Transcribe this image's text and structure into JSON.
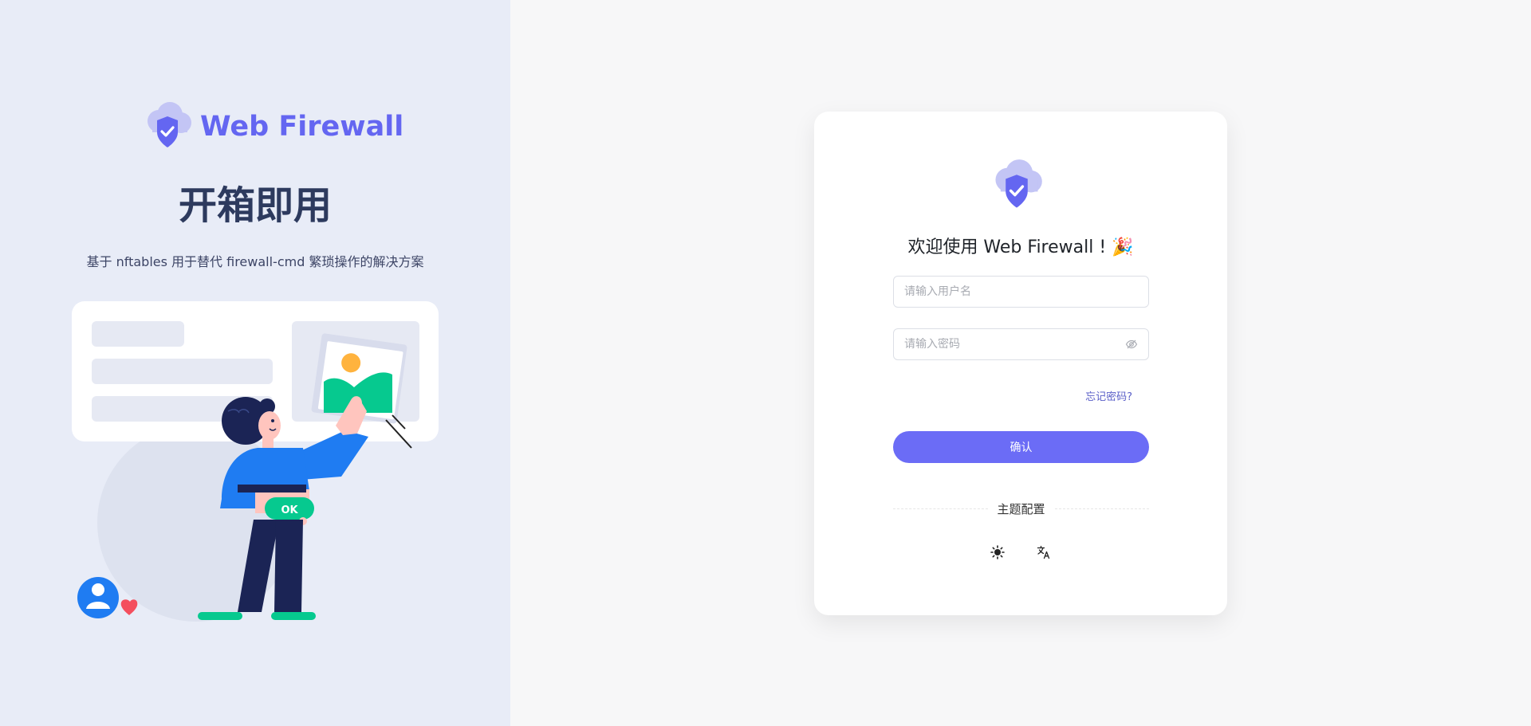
{
  "brand": {
    "name": "Web Firewall"
  },
  "hero": {
    "slogan": "开箱即用",
    "description": "基于 nftables 用于替代 firewall-cmd 繁琐操作的解决方案"
  },
  "login": {
    "welcome": "欢迎使用 Web Firewall ! 🎉",
    "username_placeholder": "请输入用户名",
    "password_placeholder": "请输入密码",
    "forgot_label": "忘记密码?",
    "submit_label": "确认",
    "theme_label": "主题配置"
  },
  "icons": {
    "logo": "cloud-shield-icon",
    "eye": "eye-icon",
    "sun": "sun-icon",
    "translate": "translate-icon"
  },
  "colors": {
    "accent": "#6b6cf6",
    "brand_text": "#6466f1",
    "left_bg": "#e8ecf7",
    "illustration_green": "#06c98f",
    "illustration_blue": "#1f7cf2"
  }
}
